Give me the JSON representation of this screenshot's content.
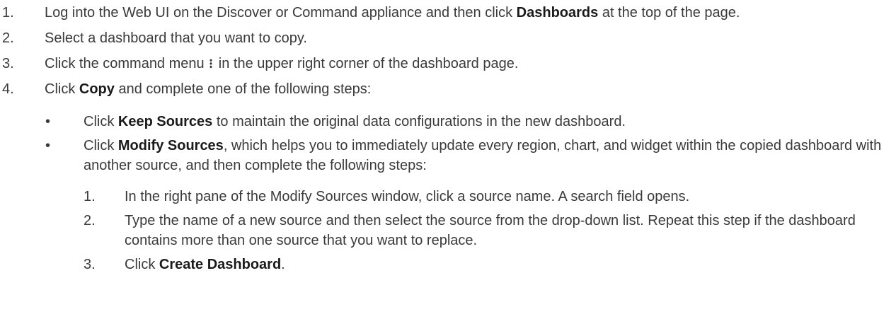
{
  "steps": [
    {
      "num": "1.",
      "before": "Log into the Web UI on the Discover or Command appliance and then click ",
      "bold": "Dashboards",
      "after": " at the top of the page."
    },
    {
      "num": "2.",
      "text": "Select a dashboard that you want to copy."
    },
    {
      "num": "3.",
      "before": "Click the command menu",
      "icon": "kebab-menu-icon",
      "after": " in the upper right corner of the dashboard page."
    },
    {
      "num": "4.",
      "before": "Click ",
      "bold": "Copy",
      "after": " and complete one of the following steps:"
    }
  ],
  "bullets": [
    {
      "marker": "•",
      "before": "Click ",
      "bold": "Keep Sources",
      "after": " to maintain the original data configurations in the new dashboard."
    },
    {
      "marker": "•",
      "before": "Click ",
      "bold": "Modify Sources",
      "after": ", which helps you to immediately update every region, chart, and widget within the copied dashboard with another source, and then complete the following steps:"
    }
  ],
  "substeps": [
    {
      "num": "1.",
      "text": "In the right pane of the Modify Sources window, click a source name. A search field opens."
    },
    {
      "num": "2.",
      "text": "Type the name of a new source and then select the source from the drop-down list. Repeat this step if the dashboard contains more than one source that you want to replace."
    },
    {
      "num": "3.",
      "before": "Click ",
      "bold": "Create Dashboard",
      "after": "."
    }
  ]
}
